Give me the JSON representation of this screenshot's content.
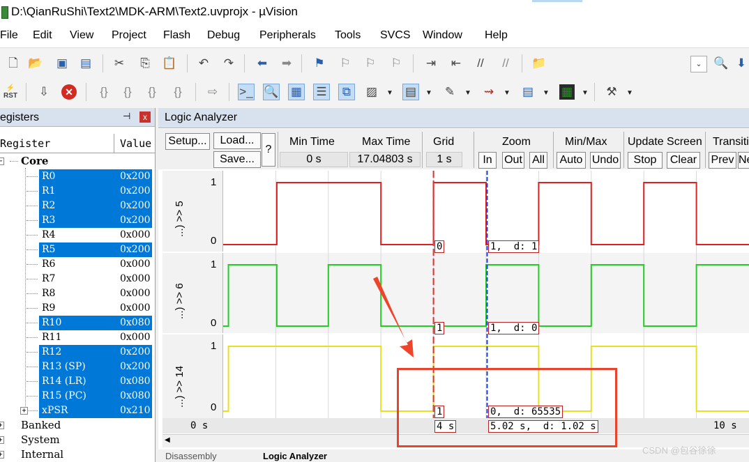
{
  "window": {
    "title": "D:\\QianRuShi\\Text2\\MDK-ARM\\Text2.uvprojx - µVision"
  },
  "menu": [
    "File",
    "Edit",
    "View",
    "Project",
    "Flash",
    "Debug",
    "Peripherals",
    "Tools",
    "SVCS",
    "Window",
    "Help"
  ],
  "registers": {
    "title": "egisters",
    "pin": "⊣",
    "close": "x",
    "col_register": "Register",
    "col_value": "Value",
    "core_label": "Core",
    "rows": [
      {
        "name": "R0",
        "value": "0x200",
        "selected": true
      },
      {
        "name": "R1",
        "value": "0x200",
        "selected": true
      },
      {
        "name": "R2",
        "value": "0x200",
        "selected": true
      },
      {
        "name": "R3",
        "value": "0x200",
        "selected": true
      },
      {
        "name": "R4",
        "value": "0x000",
        "selected": false
      },
      {
        "name": "R5",
        "value": "0x200",
        "selected": true
      },
      {
        "name": "R6",
        "value": "0x000",
        "selected": false
      },
      {
        "name": "R7",
        "value": "0x000",
        "selected": false
      },
      {
        "name": "R8",
        "value": "0x000",
        "selected": false
      },
      {
        "name": "R9",
        "value": "0x000",
        "selected": false
      },
      {
        "name": "R10",
        "value": "0x080",
        "selected": true
      },
      {
        "name": "R11",
        "value": "0x000",
        "selected": false
      },
      {
        "name": "R12",
        "value": "0x200",
        "selected": true
      },
      {
        "name": "R13 (SP)",
        "value": "0x200",
        "selected": true
      },
      {
        "name": "R14 (LR)",
        "value": "0x080",
        "selected": true
      },
      {
        "name": "R15 (PC)",
        "value": "0x080",
        "selected": true
      },
      {
        "name": "xPSR",
        "value": "0x210",
        "selected": true
      }
    ],
    "groups": [
      "Banked",
      "System",
      "Internal"
    ]
  },
  "logic": {
    "title": "Logic Analyzer",
    "setup": "Setup...",
    "load": "Load...",
    "save": "Save...",
    "help": "?",
    "min_time_label": "Min Time",
    "min_time": "0 s",
    "max_time_label": "Max Time",
    "max_time": "17.04803 s",
    "grid_label": "Grid",
    "grid": "1 s",
    "zoom_label": "Zoom",
    "zoom_in": "In",
    "zoom_out": "Out",
    "zoom_all": "All",
    "minmax_label": "Min/Max",
    "auto": "Auto",
    "undo": "Undo",
    "update_label": "Update Screen",
    "stop": "Stop",
    "clear": "Clear",
    "transition_label": "Transiti",
    "prev": "Prev",
    "next": "Ne",
    "signals": [
      {
        "name": "...) >> 5",
        "hi": "1",
        "lo": "0",
        "color": "#e02020",
        "edges": [
          0,
          1.02,
          3,
          4,
          5,
          6,
          7,
          8,
          9,
          10
        ],
        "init": 0,
        "marker_left": "0",
        "marker_right": "1,  d: 1"
      },
      {
        "name": "...) >> 6",
        "hi": "1",
        "lo": "0",
        "color": "#22cc22",
        "edges": [
          0,
          0.1,
          1.02,
          2,
          3,
          5,
          6,
          7,
          8,
          9,
          10
        ],
        "init": 0,
        "marker_left": "1",
        "marker_right": "1,  d: 0"
      },
      {
        "name": "...) >> 14",
        "hi": "1",
        "lo": "0",
        "color": "#e6e020",
        "edges": [
          0,
          0.1,
          3,
          4,
          6,
          7,
          9,
          10
        ],
        "init": 0,
        "marker_left": "1",
        "marker_right": "0,  d: 65535"
      }
    ],
    "time_start": "0 s",
    "time_end": "10 s",
    "cursor_time": "4 s",
    "cursor_delta": "5.02 s,  d: 1.02 s",
    "tabs": [
      "Disassembly",
      "Logic Analyzer"
    ]
  },
  "watermark": "CSDN @包谷徐徐"
}
